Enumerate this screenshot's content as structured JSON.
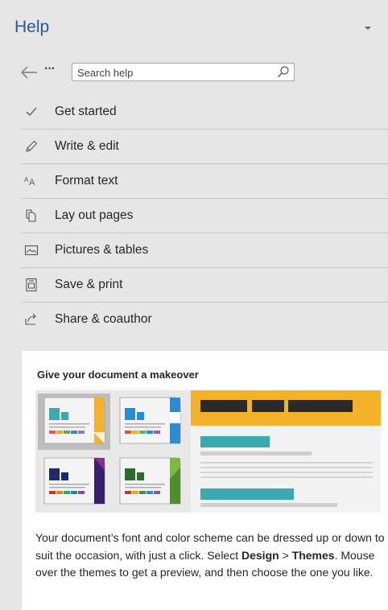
{
  "pane": {
    "title": "Help"
  },
  "toolbar": {
    "more_label": "···",
    "search_placeholder": "Search help"
  },
  "menu": {
    "items": [
      {
        "label": "Get started",
        "icon": "checkmark-icon"
      },
      {
        "label": "Write & edit",
        "icon": "pencil-icon"
      },
      {
        "label": "Format text",
        "icon": "font-size-icon"
      },
      {
        "label": "Lay out pages",
        "icon": "pages-icon"
      },
      {
        "label": "Pictures & tables",
        "icon": "picture-icon"
      },
      {
        "label": "Save & print",
        "icon": "save-print-icon"
      },
      {
        "label": "Share & coauthor",
        "icon": "share-icon"
      }
    ]
  },
  "card": {
    "title": "Give your document a makeover",
    "body_part1": "Your document’s font and color scheme can be dressed up or down to suit the occasion, with just a click. Select ",
    "body_bold1": "Design",
    "body_part2": " > ",
    "body_bold2": "Themes",
    "body_part3": ". Mouse over the themes to get a preview, and then choose the one you like."
  },
  "colors": {
    "accent_blue": "#2b579a",
    "theme_orange": "#f4b12a",
    "theme_teal": "#3aa9b0",
    "theme_dark": "#2a2a2a",
    "pane_bg": "#e6e6e6"
  }
}
